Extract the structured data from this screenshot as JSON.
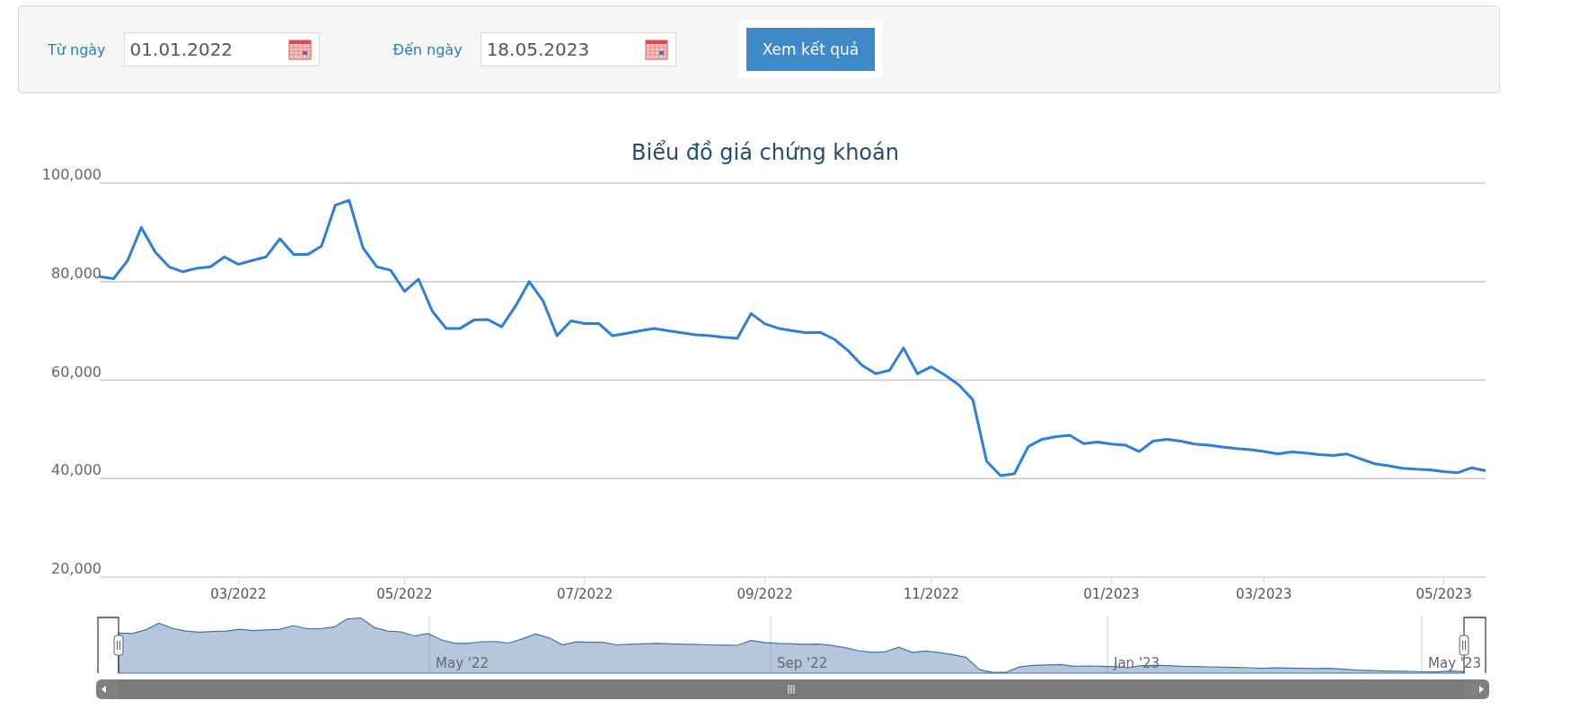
{
  "filter": {
    "from": {
      "label": "Từ ngày",
      "value": "01.01.2022"
    },
    "to": {
      "label": "Đến ngày",
      "value": "18.05.2023"
    },
    "submit": "Xem kết quả"
  },
  "chart": {
    "chart_data": {
      "type": "line",
      "title": "Biểu đồ giá chứng khoán",
      "categories": [
        null,
        null,
        null,
        null,
        null,
        null,
        null,
        null,
        null,
        null,
        "03/2022",
        null,
        null,
        null,
        null,
        null,
        null,
        null,
        null,
        null,
        null,
        null,
        "05/2022",
        null,
        null,
        null,
        null,
        null,
        null,
        null,
        null,
        null,
        null,
        null,
        null,
        "07/2022",
        null,
        null,
        null,
        null,
        null,
        null,
        null,
        null,
        null,
        null,
        null,
        null,
        "09/2022",
        null,
        null,
        null,
        null,
        null,
        null,
        null,
        null,
        null,
        null,
        null,
        "11/2022",
        null,
        null,
        null,
        null,
        null,
        null,
        null,
        null,
        null,
        null,
        null,
        null,
        "01/2023",
        null,
        null,
        null,
        null,
        null,
        null,
        null,
        null,
        null,
        null,
        "03/2023",
        null,
        null,
        null,
        null,
        null,
        null,
        null,
        null,
        null,
        null,
        null,
        null,
        "05/2023",
        null,
        null,
        null
      ],
      "series": [
        {
          "color": "#2f7ed8",
          "values": [
            81000,
            80600,
            84200,
            91000,
            86000,
            83000,
            82000,
            82700,
            83000,
            85000,
            83500,
            84300,
            85000,
            88700,
            85500,
            85500,
            87200,
            95500,
            96500,
            86800,
            83000,
            82300,
            78000,
            80500,
            74000,
            70500,
            70500,
            72200,
            72300,
            70800,
            75000,
            80000,
            76000,
            69000,
            72000,
            71500,
            71500,
            69000,
            69500,
            70000,
            70500,
            70000,
            69600,
            69200,
            69000,
            68700,
            68500,
            73500,
            71400,
            70500,
            70000,
            69600,
            69700,
            68300,
            66000,
            63000,
            61300,
            62000,
            66500,
            61300,
            62700,
            61000,
            59000,
            56000,
            43500,
            40600,
            41000,
            46500,
            48000,
            48500,
            48800,
            47100,
            47400,
            47000,
            46800,
            45500,
            47600,
            48000,
            47600,
            47000,
            46800,
            46400,
            46100,
            45900,
            45500,
            45000,
            45400,
            45200,
            44900,
            44700,
            45000,
            44000,
            43000,
            42600,
            42100,
            41900,
            41800,
            41400,
            41200,
            42200,
            41600
          ]
        }
      ],
      "grid": true,
      "ylim": [
        20000,
        100000
      ],
      "yticks": [
        {
          "value": 20000,
          "label": "20,000"
        },
        {
          "value": 40000,
          "label": "40,000"
        },
        {
          "value": 60000,
          "label": "60,000"
        },
        {
          "value": 80000,
          "label": "80,000"
        },
        {
          "value": 100000,
          "label": "100,000"
        }
      ]
    }
  },
  "navigator": {
    "labels": [
      "May '22",
      "Sep '22",
      "Jan '23",
      "May '23"
    ]
  }
}
